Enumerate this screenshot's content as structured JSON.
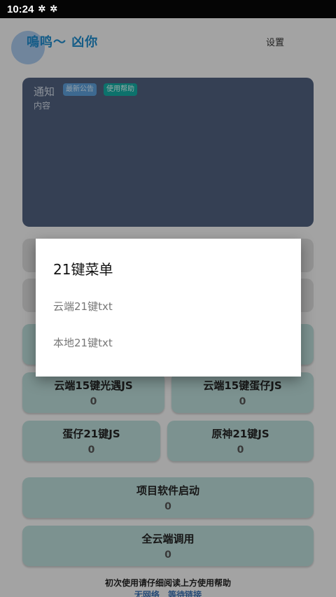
{
  "status_bar": {
    "time": "10:24",
    "icons": [
      "bug-icon",
      "bug-icon"
    ]
  },
  "header": {
    "title": "嗚鸣～ 凶你",
    "settings_label": "设置"
  },
  "notice": {
    "title": "通知",
    "body": "内容",
    "chip_announcement": "最新公告",
    "chip_help": "使用帮助"
  },
  "cards": [
    {
      "label": "云端15键光遇JS",
      "count": "0"
    },
    {
      "label": "云端15键蛋仔JS",
      "count": "0"
    },
    {
      "label": "蛋仔21键JS",
      "count": "0"
    },
    {
      "label": "原神21键JS",
      "count": "0"
    },
    {
      "label": "项目软件启动",
      "count": "0"
    },
    {
      "label": "全云端调用",
      "count": "0"
    }
  ],
  "footer": {
    "note": "初次使用请仔细阅读上方使用帮助",
    "network": "无网络",
    "link": "等待链接"
  },
  "dialog": {
    "title": "21键菜单",
    "items": [
      "云端21键txt",
      "本地21键txt"
    ]
  },
  "colors": {
    "accent": "#1e88c8",
    "card": "#b7d7d4",
    "notice": "#4e5f7c",
    "help_chip": "#14a8a0"
  }
}
